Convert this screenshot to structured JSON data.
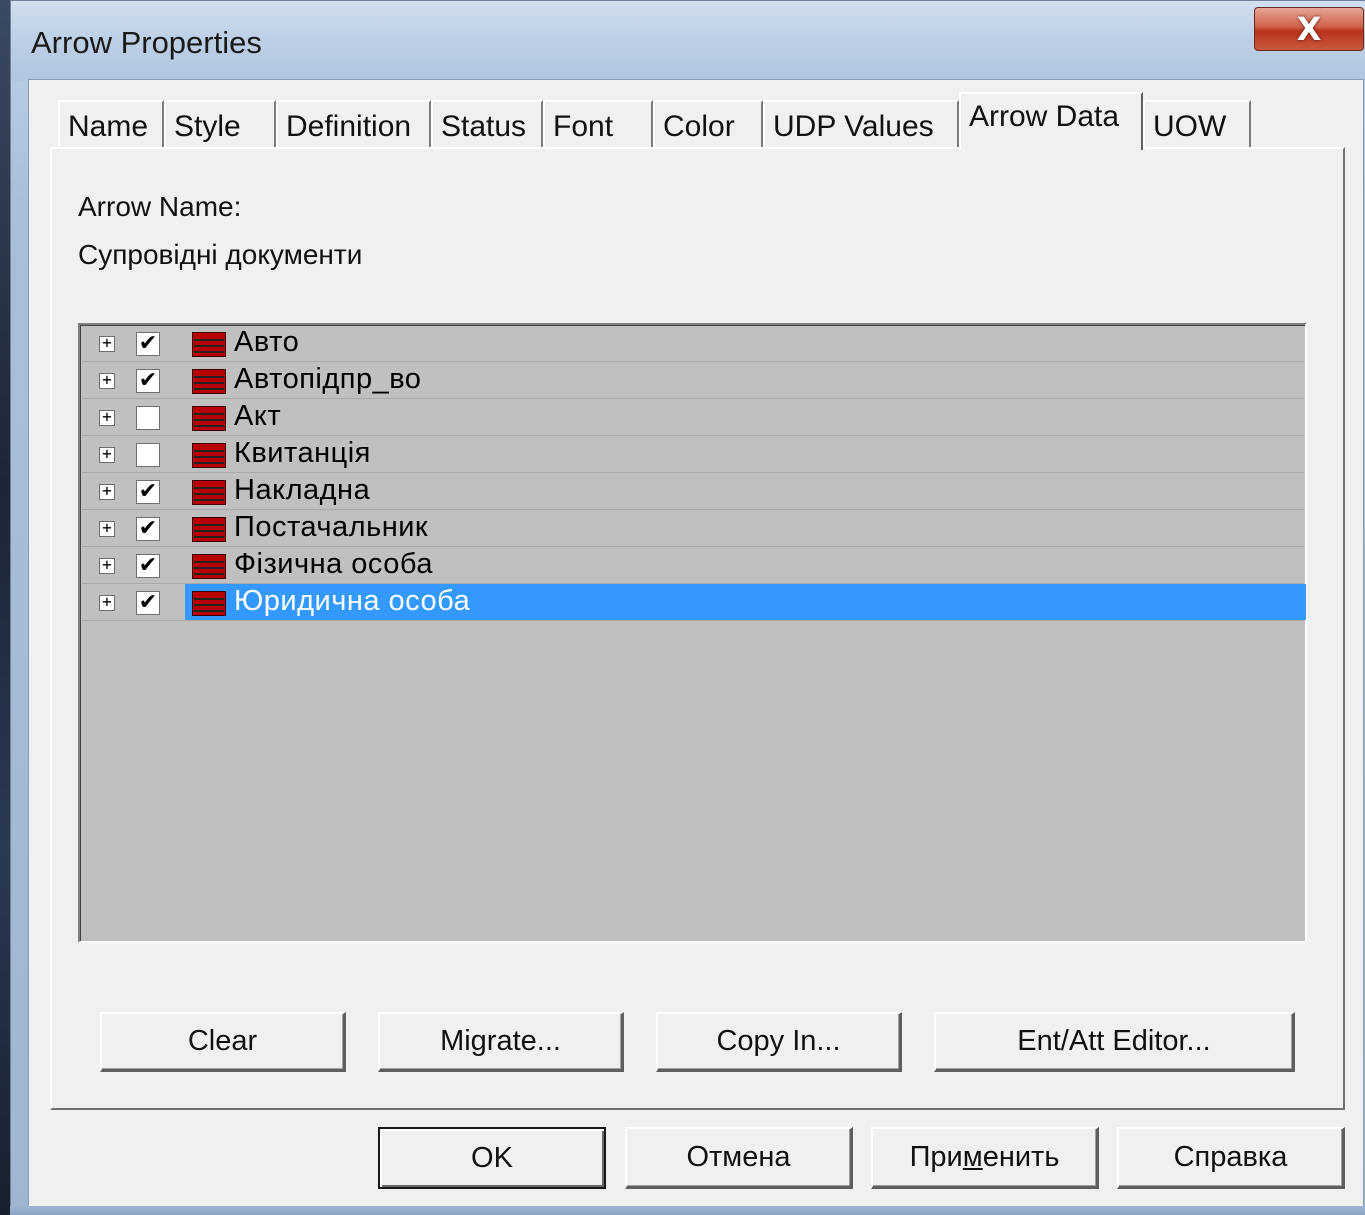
{
  "window": {
    "title": "Arrow Properties",
    "close_label": "X"
  },
  "tabs": [
    {
      "label": "Name",
      "active": false
    },
    {
      "label": "Style",
      "active": false
    },
    {
      "label": "Definition",
      "active": false
    },
    {
      "label": "Status",
      "active": false
    },
    {
      "label": "Font",
      "active": false
    },
    {
      "label": "Color",
      "active": false
    },
    {
      "label": "UDP Values",
      "active": false
    },
    {
      "label": "Arrow Data",
      "active": true
    },
    {
      "label": "UOW",
      "active": false
    }
  ],
  "panel": {
    "arrow_name_label": "Arrow Name:",
    "arrow_name_value": "Супровідні документи"
  },
  "tree": {
    "expander_glyph": "+",
    "check_glyph": "✔",
    "items": [
      {
        "label": "Авто",
        "checked": true,
        "selected": false
      },
      {
        "label": "Автопідпр_во",
        "checked": true,
        "selected": false
      },
      {
        "label": "Акт",
        "checked": false,
        "selected": false
      },
      {
        "label": "Квитанція",
        "checked": false,
        "selected": false
      },
      {
        "label": "Накладна",
        "checked": true,
        "selected": false
      },
      {
        "label": "Постачальник",
        "checked": true,
        "selected": false
      },
      {
        "label": "Фізична особа",
        "checked": true,
        "selected": false
      },
      {
        "label": "Юридична особа",
        "checked": true,
        "selected": true
      }
    ]
  },
  "action_buttons": {
    "clear": "Clear",
    "migrate": "Migrate...",
    "copy_in": "Copy In...",
    "ent_att_editor": "Ent/Att Editor..."
  },
  "dialog_buttons": {
    "ok": "OK",
    "cancel": "Отмена",
    "apply_pre": "При",
    "apply_mnemonic": "м",
    "apply_post": "енить",
    "help": "Справка"
  },
  "colors": {
    "selection": "#3399ff",
    "entity_icon": "#b90000",
    "list_background": "#c0c0c0",
    "dialog_background": "#f0f0f0"
  }
}
